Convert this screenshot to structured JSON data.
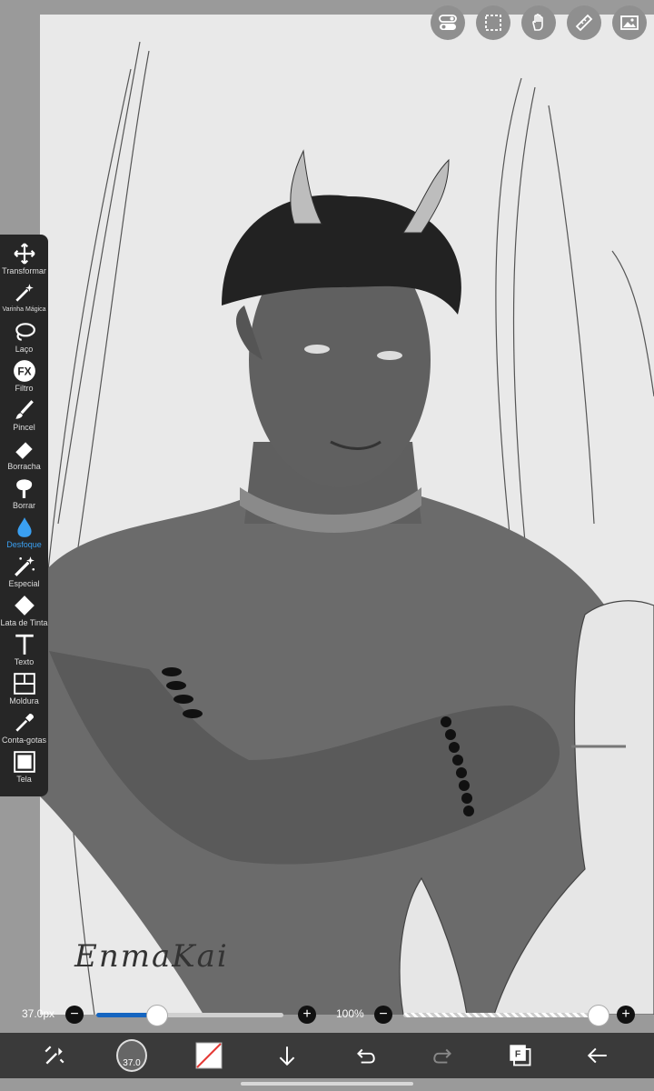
{
  "top_toolbar": {
    "icons": [
      "toggles-icon",
      "selection-icon",
      "hand-icon",
      "ruler-icon",
      "gallery-icon"
    ]
  },
  "tools": [
    {
      "label": "Transformar",
      "icon": "move-arrows-icon",
      "active": false
    },
    {
      "label": "Varinha Mágica",
      "icon": "magic-wand-icon",
      "active": false
    },
    {
      "label": "Laço",
      "icon": "lasso-icon",
      "active": false
    },
    {
      "label": "Filtro",
      "icon": "fx-icon",
      "active": false
    },
    {
      "label": "Pincel",
      "icon": "brush-icon",
      "active": false
    },
    {
      "label": "Borracha",
      "icon": "eraser-icon",
      "active": false
    },
    {
      "label": "Borrar",
      "icon": "smudge-icon",
      "active": false
    },
    {
      "label": "Desfoque",
      "icon": "blur-drop-icon",
      "active": true
    },
    {
      "label": "Especial",
      "icon": "special-wand-icon",
      "active": false
    },
    {
      "label": "Lata de Tinta",
      "icon": "paint-bucket-icon",
      "active": false
    },
    {
      "label": "Texto",
      "icon": "text-icon",
      "active": false
    },
    {
      "label": "Moldura",
      "icon": "frame-icon",
      "active": false
    },
    {
      "label": "Conta-gotas",
      "icon": "eyedropper-icon",
      "active": false
    },
    {
      "label": "Tela",
      "icon": "canvas-icon",
      "active": false
    }
  ],
  "brush_size": {
    "label": "37.0px",
    "minus": "−",
    "plus": "+",
    "value_fraction": 0.32
  },
  "opacity": {
    "label": "100%",
    "minus": "−",
    "plus": "+",
    "value_percent": 100
  },
  "bottom_bar": {
    "brush_badge": "37.0",
    "icons": [
      "transform-swap-icon",
      "brush-size-icon",
      "color-swatch-icon",
      "download-icon",
      "undo-icon",
      "redo-icon",
      "layers-icon",
      "back-icon"
    ]
  },
  "signature_text": "EnmaKai",
  "colors": {
    "accent": "#3aa0f2",
    "palette_bg": "#262626",
    "bottom_bar_bg": "#3a3a3a"
  }
}
